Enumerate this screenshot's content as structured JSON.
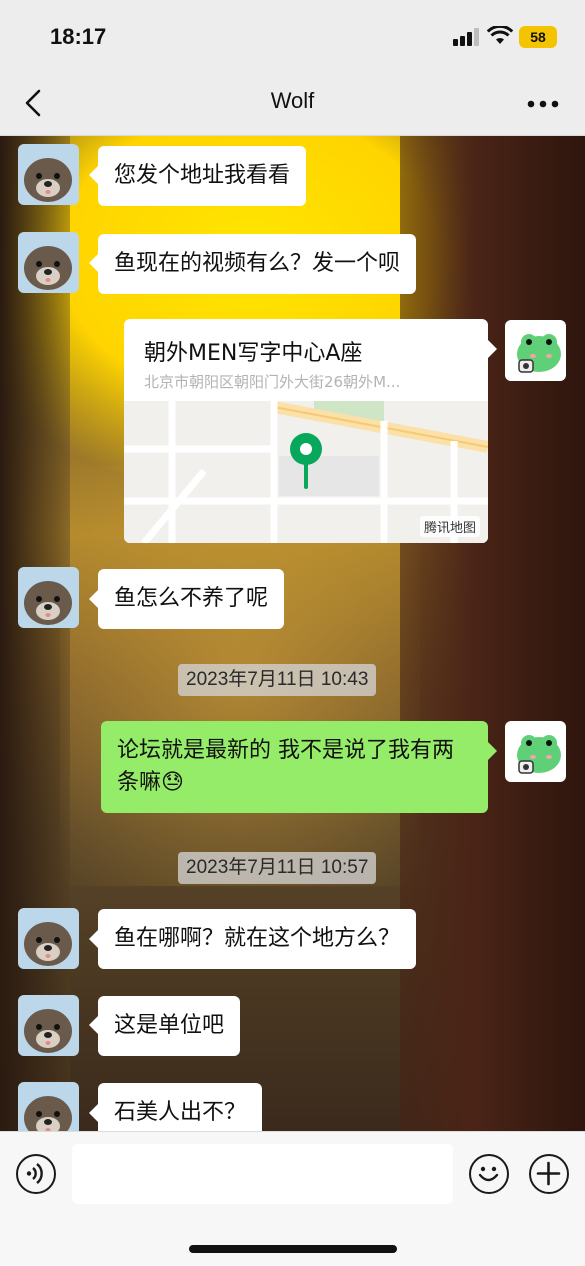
{
  "status_bar": {
    "time": "18:17",
    "battery": "58"
  },
  "header": {
    "title": "Wolf"
  },
  "messages": [
    {
      "text": "您发个地址我看看"
    },
    {
      "text": "鱼现在的视频有么？发一个呗"
    },
    {
      "location_name": "朝外MEN写字中心A座",
      "location_address": "北京市朝阳区朝阳门外大街26朝外M...",
      "map_credit": "腾讯地图"
    },
    {
      "text": "鱼怎么不养了呢"
    },
    {
      "timestamp": "2023年7月11日 10:43"
    },
    {
      "text": "论坛就是最新的 我不是说了我有两条嘛",
      "emoji": "😓"
    },
    {
      "timestamp": "2023年7月11日 10:57"
    },
    {
      "text": "鱼在哪啊？就在这个地方么？"
    },
    {
      "text": "这是单位吧"
    },
    {
      "text": "石美人出不？"
    }
  ],
  "colors": {
    "accent_green": "#95ec69",
    "bubble_white": "#ffffff",
    "map_pin": "#07a85b"
  },
  "icons": [
    "back-icon",
    "more-icon",
    "voice-icon",
    "emoji-icon",
    "plus-icon",
    "wifi-icon",
    "signal-icon"
  ]
}
